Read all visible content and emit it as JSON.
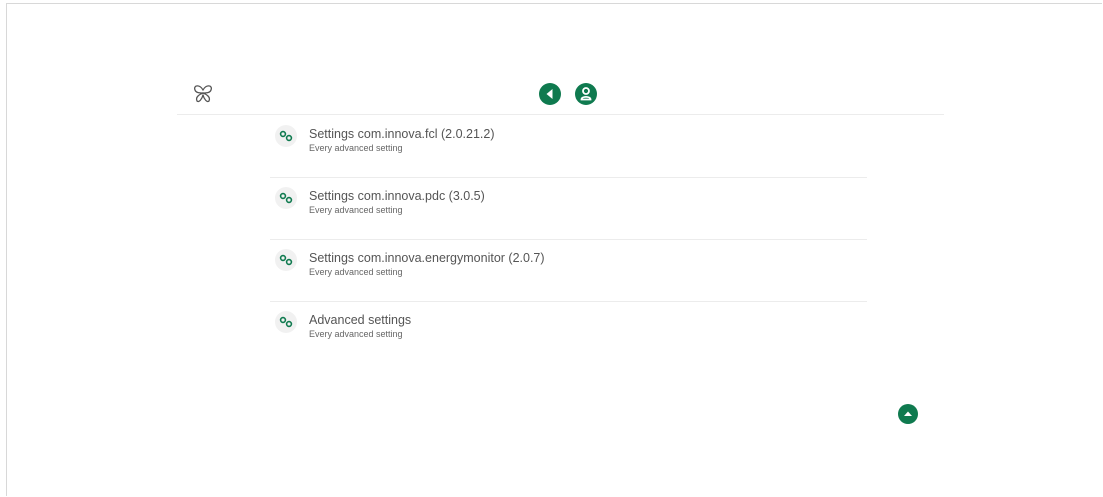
{
  "header": {
    "logo_icon": "butterfly-icon",
    "back_icon": "back-arrow-icon",
    "user_icon": "user-icon",
    "accent_color": "#0f7a4f"
  },
  "settings_list": {
    "items": [
      {
        "title": "Settings com.innova.fcl (2.0.21.2)",
        "subtitle": "Every advanced setting",
        "icon": "gears-icon"
      },
      {
        "title": "Settings com.innova.pdc (3.0.5)",
        "subtitle": "Every advanced setting",
        "icon": "gears-icon"
      },
      {
        "title": "Settings com.innova.energymonitor (2.0.7)",
        "subtitle": "Every advanced setting",
        "icon": "gears-icon"
      },
      {
        "title": "Advanced settings",
        "subtitle": "Every advanced setting",
        "icon": "gears-icon"
      }
    ]
  },
  "scroll_top": {
    "icon": "caret-up-icon"
  }
}
